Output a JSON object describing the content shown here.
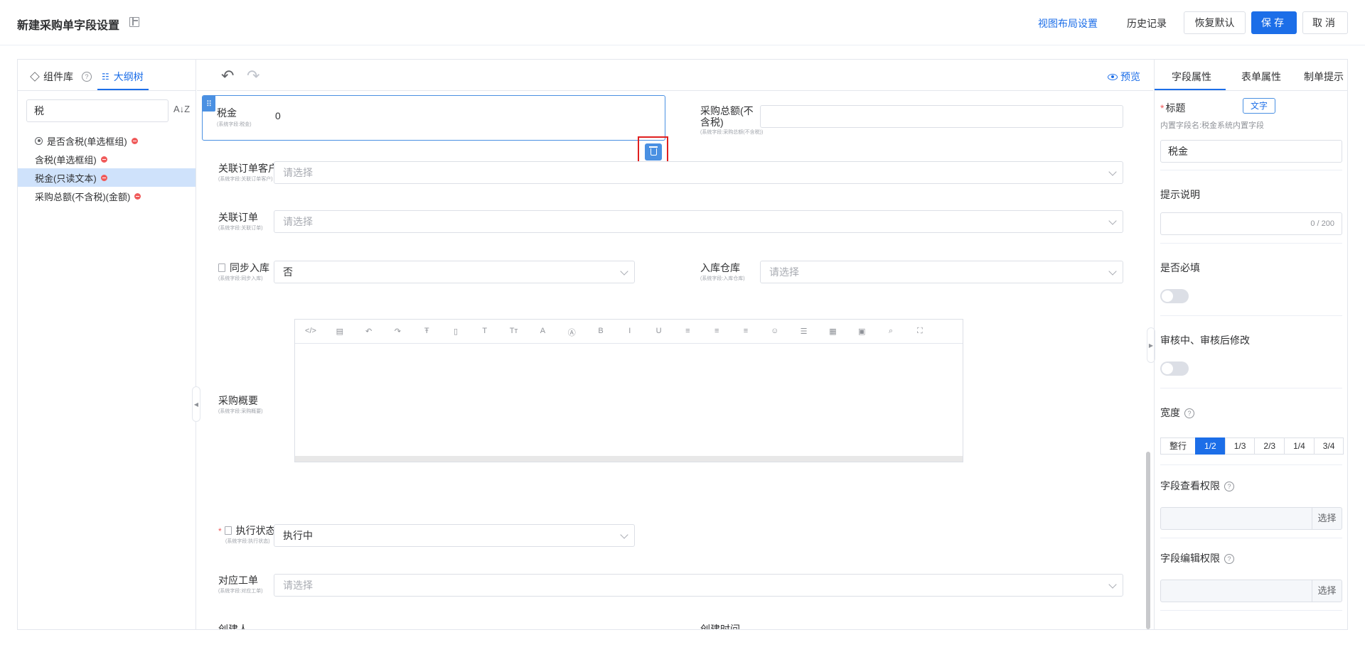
{
  "header": {
    "title": "新建采购单字段设置",
    "view_layout": "视图布局设置",
    "history": "历史记录",
    "restore_default": "恢复默认",
    "save": "保存",
    "cancel": "取消"
  },
  "left_panel": {
    "tabs": [
      "组件库",
      "大纲树"
    ],
    "search_value": "税",
    "tree_items": [
      "是否含税(单选框组)",
      "含税(单选框组)",
      "税金(只读文本)",
      "采购总额(不含税)(金额)"
    ],
    "selected_index": 2
  },
  "toolbar": {
    "preview": "预览"
  },
  "fields": {
    "tax": {
      "label": "税金",
      "sub": "(系统字段:税金)",
      "value": "0"
    },
    "total_ex_tax": {
      "label": "采购总额(不含税)",
      "sub": "(系统字段:采购总额(不含税))"
    },
    "related_customer": {
      "label": "关联订单客户",
      "sub": "(系统字段:关联订单客户)",
      "placeholder": "请选择"
    },
    "related_order": {
      "label": "关联订单",
      "sub": "(系统字段:关联订单)",
      "placeholder": "请选择"
    },
    "sync_stock": {
      "label": "同步入库",
      "sub": "(系统字段:同步入库)",
      "value": "否"
    },
    "warehouse": {
      "label": "入库仓库",
      "sub": "(系统字段:入库仓库)",
      "placeholder": "请选择"
    },
    "summary": {
      "label": "采购概要",
      "sub": "(系统字段:采购概要)"
    },
    "exec_status": {
      "label": "执行状态",
      "sub": "(系统字段:执行状态)",
      "value": "执行中"
    },
    "work_order": {
      "label": "对应工单",
      "sub": "(系统字段:对应工单)",
      "placeholder": "请选择"
    },
    "creator": {
      "label": "创建人"
    },
    "created_time": {
      "label": "创建时间"
    }
  },
  "editor_tools": [
    "</>",
    "▤",
    "↶",
    "↷",
    "Ŧ",
    "▯",
    "T",
    "Tт",
    "A",
    "Ⓐ",
    "B",
    "I",
    "U",
    "≡",
    "≡",
    "≡",
    "☺",
    "☰",
    "▦",
    "▣",
    "⌕",
    "⛶"
  ],
  "right_panel": {
    "tabs": [
      "字段属性",
      "表单属性",
      "制单提示"
    ],
    "title_label": "标题",
    "title_tag": "文字",
    "builtin_note": "内置字段名:税金系统内置字段",
    "title_value": "税金",
    "hint_label": "提示说明",
    "hint_counter": "0 / 200",
    "required_label": "是否必填",
    "review_label": "审核中、审核后修改",
    "width_label": "宽度",
    "width_options": [
      "整行",
      "1/2",
      "1/3",
      "2/3",
      "1/4",
      "3/4"
    ],
    "width_selected": "1/2",
    "view_perm_label": "字段查看权限",
    "edit_perm_label": "字段编辑权限",
    "choose": "选择",
    "required_off": false,
    "review_off": false
  },
  "colors": {
    "accent": "#1c6ee8",
    "danger": "#e02020"
  }
}
